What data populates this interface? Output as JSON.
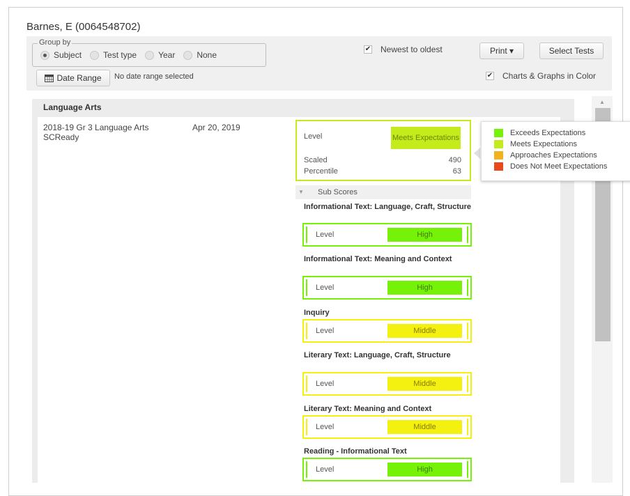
{
  "student": {
    "name": "Barnes, E (0064548702)"
  },
  "options": {
    "group_by_label": "Group by",
    "group_by_options": [
      {
        "label": "Subject",
        "selected": true
      },
      {
        "label": "Test type",
        "selected": false
      },
      {
        "label": "Year",
        "selected": false
      },
      {
        "label": "None",
        "selected": false
      }
    ],
    "newest_to_oldest": {
      "label": "Newest to oldest",
      "checked": true,
      "mark": "✔"
    },
    "charts_in_color": {
      "label": "Charts & Graphs in Color",
      "checked": true,
      "mark": "✔"
    },
    "print_label": "Print ▾",
    "select_tests_label": "Select Tests",
    "date_range_label": "Date Range",
    "date_range_icon": "calendar-icon",
    "date_range_text": "No date range selected"
  },
  "section": {
    "title": "Language Arts",
    "test": {
      "name": "2018-19 Gr 3 Language Arts SCReady",
      "date": "Apr 20, 2019",
      "level_label": "Level",
      "level_value": "Meets Expectations",
      "scaled_label": "Scaled",
      "scaled_value": "490",
      "percentile_label": "Percentile",
      "percentile_value": "63"
    },
    "subscores_label": "Sub Scores",
    "subscores": [
      {
        "title": "Informational Text: Language, Craft, Structure",
        "level_label": "Level",
        "value": "High"
      },
      {
        "title": "Informational Text: Meaning and Context",
        "level_label": "Level",
        "value": "High"
      },
      {
        "title": "Inquiry",
        "level_label": "Level",
        "value": "Middle"
      },
      {
        "title": "Literary Text: Language, Craft, Structure",
        "level_label": "Level",
        "value": "Middle"
      },
      {
        "title": "Literary Text: Meaning and Context",
        "level_label": "Level",
        "value": "Middle"
      },
      {
        "title": "Reading - Informational Text",
        "level_label": "Level",
        "value": "High"
      }
    ]
  },
  "legend": [
    {
      "label": "Exceeds Expectations",
      "color": "#75f207"
    },
    {
      "label": "Meets Expectations",
      "color": "#c4ec1c"
    },
    {
      "label": "Approaches Expectations",
      "color": "#f2b21c"
    },
    {
      "label": "Does Not Meet Expectations",
      "color": "#e8481c"
    }
  ],
  "colors": {
    "high": "#75f207",
    "middle": "#f4f00f",
    "meets": "#c4ec1c"
  }
}
